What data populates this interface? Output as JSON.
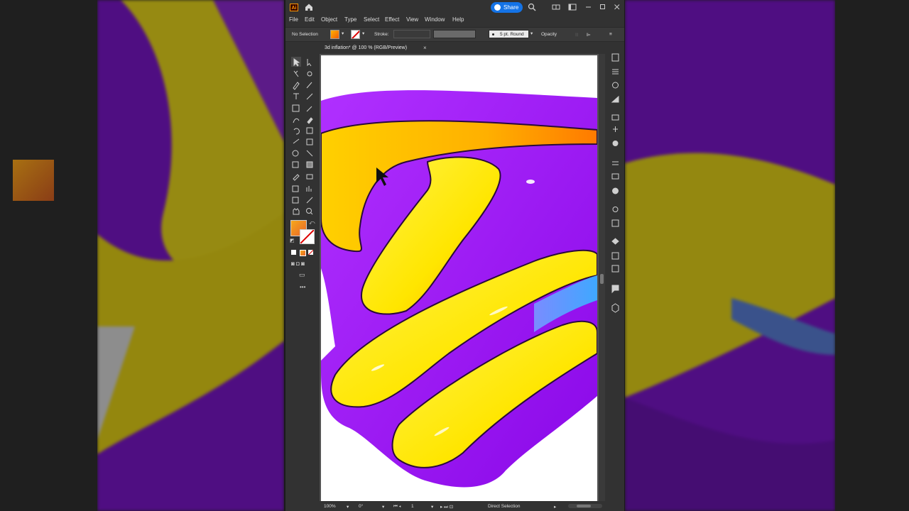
{
  "app": {
    "logo": "Ai",
    "share_label": "Share",
    "menu": [
      "File",
      "Edit",
      "Object",
      "Type",
      "Select",
      "Effect",
      "View",
      "Window",
      "Help"
    ]
  },
  "control_bar": {
    "selection": "No Selection",
    "stroke_label": "Stroke:",
    "brush_label": "5 pt. Round",
    "opacity_label": "Opacity"
  },
  "document": {
    "tab_title": "3d inflation* @ 100 % (RGB/Preview)",
    "close_glyph": "×"
  },
  "status_bar": {
    "zoom": "100%",
    "rotation": "0°",
    "artboard_index": "1",
    "tool_name": "Direct Selection"
  },
  "icons": {
    "home": "home-icon",
    "search": "search-icon",
    "arrange": "arrange-documents-icon",
    "workspace": "workspace-icon",
    "minimize": "minimize-icon",
    "maximize": "maximize-icon",
    "close": "close-icon",
    "more_tools": "•••"
  },
  "colors": {
    "fill_gradient_start": "#f7a81a",
    "fill_gradient_end": "#e8662a",
    "art_purple": "#9b12f2",
    "art_yellow": "#ffe81a",
    "art_orange": "#ff9a00",
    "share_blue": "#1473e6"
  }
}
